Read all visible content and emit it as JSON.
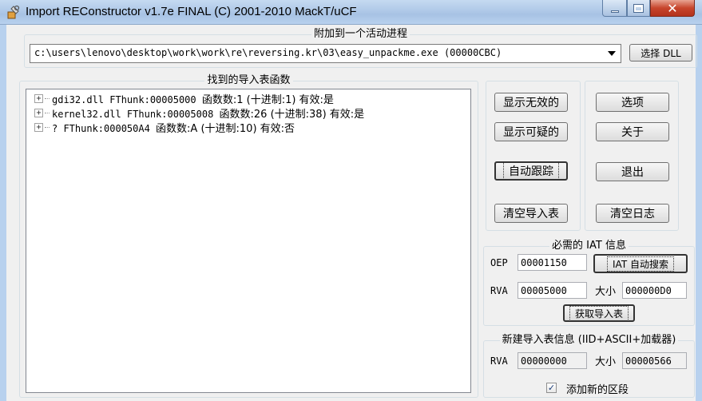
{
  "window": {
    "title": "Import REConstructor v1.7e FINAL (C) 2001-2010 MackT/uCF",
    "app_icon": "wrench-hand-icon"
  },
  "attach": {
    "group_title": "附加到一个活动进程",
    "process_value": "c:\\users\\lenovo\\desktop\\work\\work\\re\\reversing.kr\\03\\easy_unpackme.exe (00000CBC)",
    "select_dll_label": "选择 DLL"
  },
  "imports": {
    "group_title": "找到的导入表函数",
    "rows": [
      {
        "mono": "gdi32.dll FThunk:00005000 ",
        "cjk": "函数数:1 (十进制:1) 有效:是"
      },
      {
        "mono": "kernel32.dll FThunk:00005008 ",
        "cjk": "函数数:26 (十进制:38) 有效:是"
      },
      {
        "mono": "? FThunk:000050A4 ",
        "cjk": "函数数:A (十进制:10) 有效:否"
      }
    ]
  },
  "buttons": {
    "show_invalid": "显示无效的",
    "show_suspect": "显示可疑的",
    "auto_trace": "自动跟踪",
    "clear_imports": "清空导入表",
    "options": "选项",
    "about": "关于",
    "exit": "退出",
    "clear_log": "清空日志"
  },
  "iat": {
    "group_title": "必需的 IAT 信息",
    "oep_label": "OEP",
    "oep_value": "00001150",
    "autosearch_label": "IAT 自动搜索",
    "rva_label": "RVA",
    "rva_value": "00005000",
    "size_label": "大小",
    "size_value": "000000D0",
    "get_imports_label": "获取导入表"
  },
  "new_import": {
    "group_title": "新建导入表信息 (IID+ASCII+加载器)",
    "rva_label": "RVA",
    "rva_value": "00000000",
    "size_label": "大小",
    "size_value": "00000566",
    "add_section_label": "添加新的区段",
    "add_section_checked": true
  },
  "colors": {
    "title_bar": "#b8d1ee",
    "close_button": "#c7452c",
    "dialog_bg": "#f0f0f0"
  }
}
